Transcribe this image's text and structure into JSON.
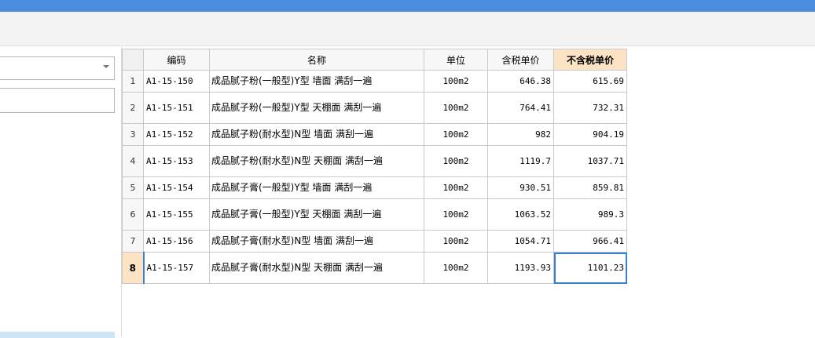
{
  "table": {
    "headers": {
      "code": "编码",
      "name": "名称",
      "unit": "单位",
      "price_tax": "含税单价",
      "price_notax": "不含税单价"
    },
    "rows": [
      {
        "no": "1",
        "code": "A1-15-150",
        "name": "成品腻子粉(一般型)Y型 墙面 满刮一遍",
        "unit": "100m2",
        "price_tax": "646.38",
        "price_notax": "615.69"
      },
      {
        "no": "2",
        "code": "A1-15-151",
        "name": "成品腻子粉(一般型)Y型 天棚面 满刮一遍",
        "unit": "100m2",
        "price_tax": "764.41",
        "price_notax": "732.31"
      },
      {
        "no": "3",
        "code": "A1-15-152",
        "name": "成品腻子粉(耐水型)N型 墙面 满刮一遍",
        "unit": "100m2",
        "price_tax": "982",
        "price_notax": "904.19"
      },
      {
        "no": "4",
        "code": "A1-15-153",
        "name": "成品腻子粉(耐水型)N型 天棚面 满刮一遍",
        "unit": "100m2",
        "price_tax": "1119.7",
        "price_notax": "1037.71"
      },
      {
        "no": "5",
        "code": "A1-15-154",
        "name": "成品腻子膏(一般型)Y型 墙面 满刮一遍",
        "unit": "100m2",
        "price_tax": "930.51",
        "price_notax": "859.81"
      },
      {
        "no": "6",
        "code": "A1-15-155",
        "name": "成品腻子膏(一般型)Y型 天棚面 满刮一遍",
        "unit": "100m2",
        "price_tax": "1063.52",
        "price_notax": "989.3"
      },
      {
        "no": "7",
        "code": "A1-15-156",
        "name": "成品腻子膏(耐水型)N型 墙面 满刮一遍",
        "unit": "100m2",
        "price_tax": "1054.71",
        "price_notax": "966.41"
      },
      {
        "no": "8",
        "code": "A1-15-157",
        "name": "成品腻子膏(耐水型)N型 天棚面 满刮一遍",
        "unit": "100m2",
        "price_tax": "1193.93",
        "price_notax": "1101.23"
      }
    ]
  },
  "colors": {
    "titlebar": "#4a8ddf",
    "header_highlight": "#fbe3c4",
    "selection_border": "#3c7fd1"
  },
  "icons": {
    "combo_arrow": "chevron-down-icon"
  }
}
